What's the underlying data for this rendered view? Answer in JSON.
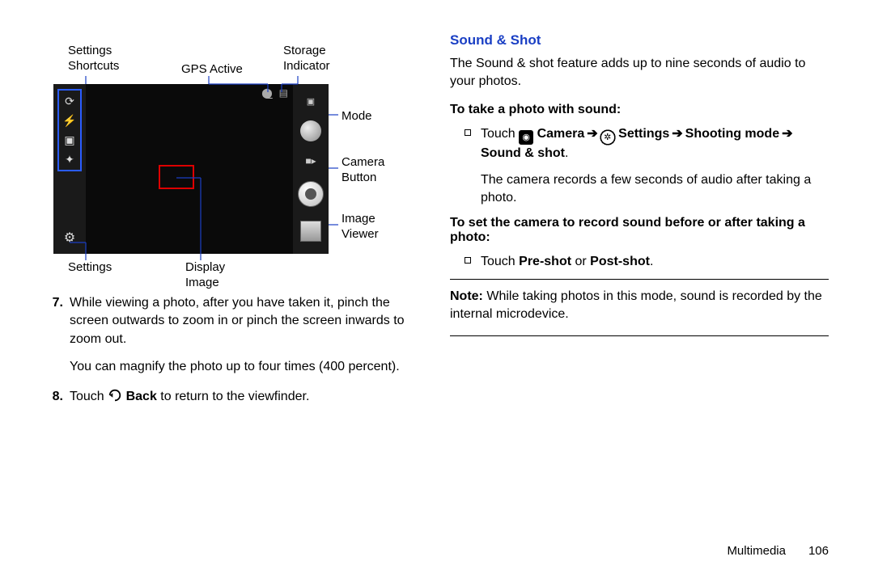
{
  "diagram": {
    "labels": {
      "settings_shortcuts": "Settings\nShortcuts",
      "gps_active": "GPS Active",
      "storage_indicator": "Storage\nIndicator",
      "mode": "Mode",
      "camera_button": "Camera\nButton",
      "image_viewer": "Image\nViewer",
      "settings": "Settings",
      "display_image": "Display\nImage"
    }
  },
  "left": {
    "item7_num": "7.",
    "item7_text": "While viewing a photo, after you have taken it, pinch the screen outwards to zoom in or pinch the screen inwards to zoom out.",
    "item7_sub": "You can magnify the photo up to four times (400 percent).",
    "item8_num": "8.",
    "item8_pre": "Touch ",
    "item8_bold": " Back",
    "item8_post": " to return to the viewfinder."
  },
  "right": {
    "heading": "Sound & Shot",
    "intro": "The Sound & shot feature adds up to nine seconds of audio to your photos.",
    "sub1": "To take a photo with sound:",
    "b1_pre": "Touch ",
    "b1_cam": " Camera",
    "b1_arr1": " ➔ ",
    "b1_set": " Settings",
    "b1_arr2": " ➔ ",
    "b1_shoot": "Shooting mode",
    "b1_arr3": " ➔ ",
    "b1_ss": "Sound & shot",
    "b1_dot": ".",
    "b1_sub": "The camera records a few seconds of audio after taking a photo.",
    "sub2": "To set the camera to record sound before or after taking a photo:",
    "b2_pre": "Touch ",
    "b2_bold1": "Pre-shot",
    "b2_mid": " or ",
    "b2_bold2": "Post-shot",
    "b2_dot": ".",
    "note_label": "Note:",
    "note_text": " While taking photos in this mode, sound is recorded by the internal microdevice."
  },
  "footer": {
    "section": "Multimedia",
    "page": "106"
  }
}
